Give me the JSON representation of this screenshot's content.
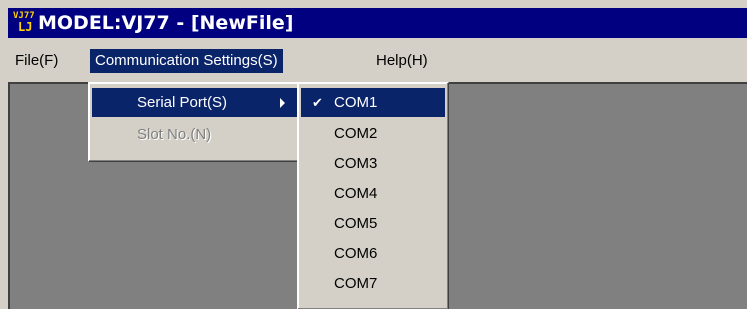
{
  "window": {
    "title": "MODEL:VJ77 - [NewFile]",
    "icon_top": "VJ77",
    "icon_bottom": "LJ"
  },
  "menubar": {
    "items": [
      {
        "label": "File(F)"
      },
      {
        "label": "Communication Settings(S)"
      },
      {
        "label": "Help(H)"
      }
    ]
  },
  "comm_menu": {
    "items": [
      {
        "label": "Serial Port(S)",
        "state": "highlighted"
      },
      {
        "label": "Slot No.(N)",
        "state": "disabled"
      }
    ]
  },
  "serial_submenu": {
    "items": [
      {
        "label": "COM1",
        "checked": true
      },
      {
        "label": "COM2"
      },
      {
        "label": "COM3"
      },
      {
        "label": "COM4"
      },
      {
        "label": "COM5"
      },
      {
        "label": "COM6"
      },
      {
        "label": "COM7"
      }
    ]
  },
  "colors": {
    "title_bar": "#000080",
    "highlight": "#0a246a",
    "face": "#d4d0c8",
    "client_area": "#808080"
  }
}
